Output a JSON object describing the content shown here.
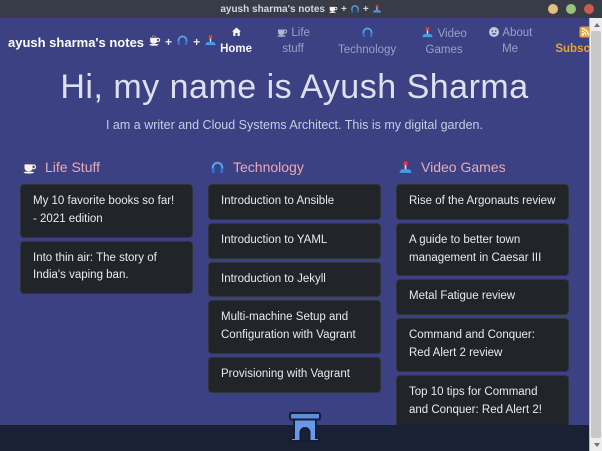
{
  "window": {
    "title": "ayush sharma's notes",
    "plus": "+",
    "controls": [
      "minimize",
      "maximize",
      "close"
    ]
  },
  "brand": {
    "text": "ayush sharma's notes",
    "plus": "+",
    "icons": [
      "coffee-icon",
      "headphones-icon",
      "joystick-icon"
    ]
  },
  "nav": {
    "items": [
      {
        "label": "Home",
        "icon": "home-icon",
        "active": true
      },
      {
        "label": "Life stuff",
        "icon": "coffee-icon",
        "active": false
      },
      {
        "label": "Technology",
        "icon": "headphones-icon",
        "active": false
      },
      {
        "label": "Video Games",
        "icon": "joystick-icon",
        "active": false
      },
      {
        "label": "About Me",
        "icon": "smiley-icon",
        "active": false
      },
      {
        "label": "Subscribe!",
        "icon": "rss-icon",
        "active": false
      }
    ]
  },
  "hero": {
    "title": "Hi, my name is Ayush Sharma",
    "subtitle": "I am a writer and Cloud Systems Architect. This is my digital garden."
  },
  "columns": [
    {
      "title": "Life Stuff",
      "icon": "coffee-icon",
      "posts": [
        "My 10 favorite books so far! - 2021 edition",
        "Into thin air: The story of India's vaping ban."
      ]
    },
    {
      "title": "Technology",
      "icon": "headphones-icon",
      "posts": [
        "Introduction to Ansible",
        "Introduction to YAML",
        "Introduction to Jekyll",
        "Multi-machine Setup and Configuration with Vagrant",
        "Provisioning with Vagrant"
      ]
    },
    {
      "title": "Video Games",
      "icon": "joystick-icon",
      "posts": [
        "Rise of the Argonauts review",
        "A guide to better town management in Caesar III",
        "Metal Fatigue review",
        "Command and Conquer: Red Alert 2 review",
        "Top 10 tips for Command and Conquer: Red Alert 2!"
      ]
    }
  ],
  "footer": {
    "logo": "arch-icon"
  },
  "colors": {
    "page_bg": "#3b4182",
    "titlebar_bg": "#373c47",
    "card_bg": "#212529",
    "column_header_pink": "#e9abb6",
    "subscribe_amber": "#e8a33c",
    "footer_bg": "#1a2134",
    "nav_muted": "#9aa1c6"
  }
}
